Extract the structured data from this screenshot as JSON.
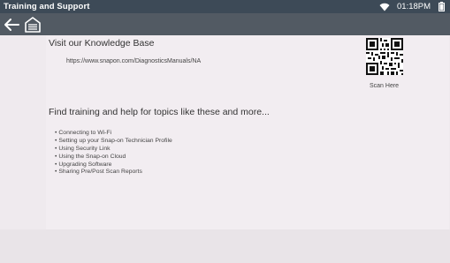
{
  "status_bar": {
    "title": "Training and Support",
    "time": "01:18PM",
    "wifi_icon": "wifi-icon",
    "battery_icon": "battery-icon"
  },
  "toolbar": {
    "back_icon": "back-arrow-icon",
    "home_icon": "home-garage-icon"
  },
  "knowledge_base": {
    "title": "Visit our Knowledge Base",
    "url": "https://www.snapon.com/DiagnosticsManuals/NA",
    "qr_icon": "qr-code-icon",
    "qr_caption": "Scan Here"
  },
  "topics": {
    "heading": "Find training and help for topics like these and more...",
    "items": [
      {
        "label": "Connecting to Wi-Fi"
      },
      {
        "label": "Setting up your Snap-on Technician Profile"
      },
      {
        "label": "Using Security Link"
      },
      {
        "label": "Using the Snap-on Cloud"
      },
      {
        "label": "Upgrading Software"
      },
      {
        "label": "Sharing Pre/Post Scan Reports"
      }
    ]
  },
  "colors": {
    "status_bar": "#3d4a57",
    "toolbar": "#525a63",
    "background": "#efeaee",
    "text": "#333333"
  }
}
